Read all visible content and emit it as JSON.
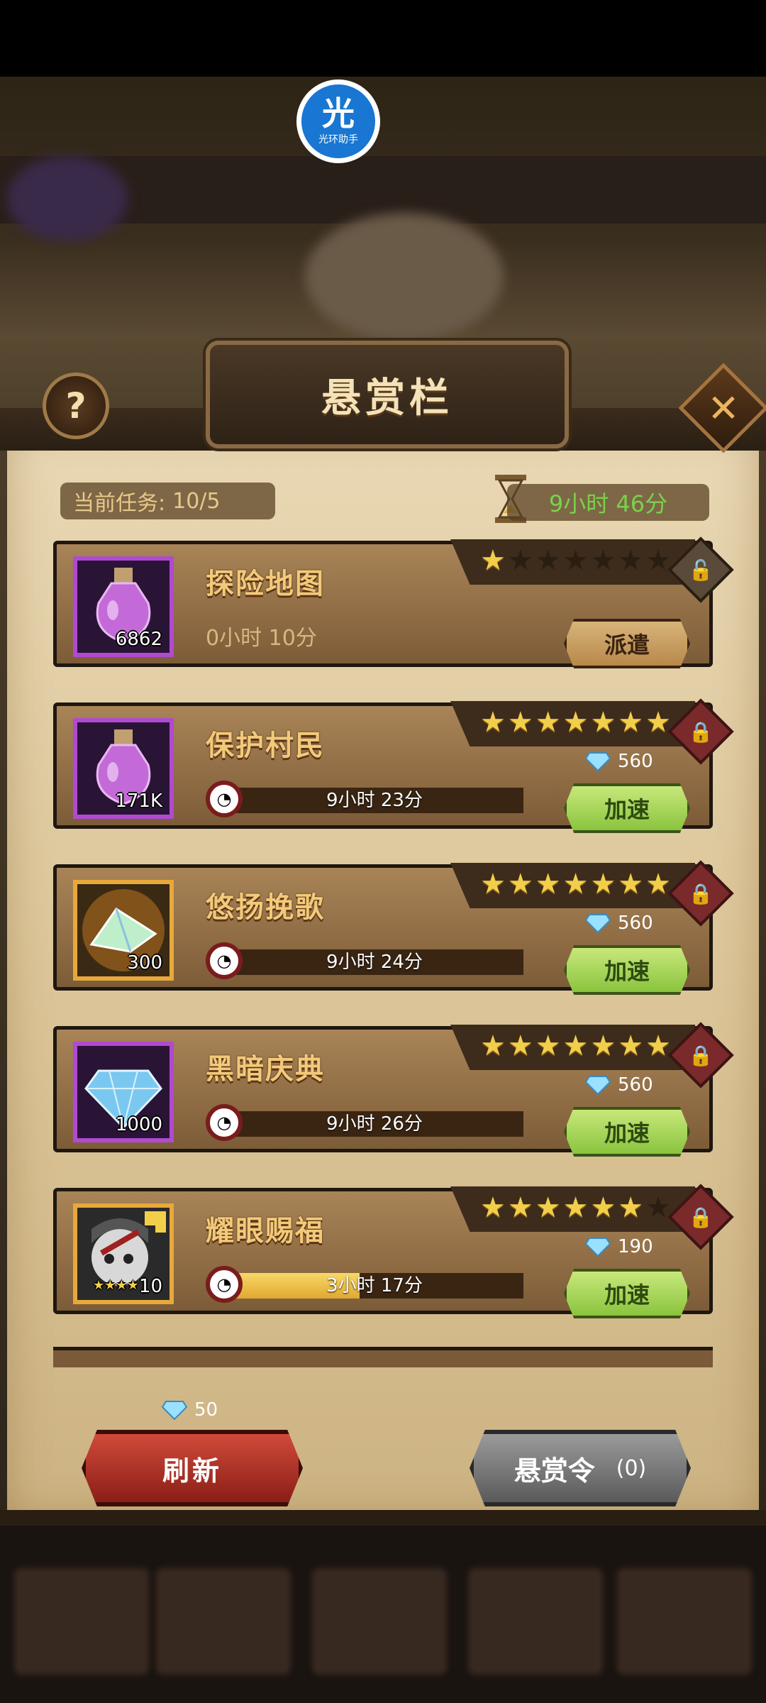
{
  "assistant": {
    "glyph": "光",
    "caption": "光环助手"
  },
  "panel": {
    "title": "悬赏栏",
    "help_label": "?",
    "close_label": "✕"
  },
  "summary": {
    "task_label": "当前任务:",
    "task_value": "10/5",
    "timer": "9小时 46分"
  },
  "tasks": [
    {
      "name": "探险地图",
      "qty": "6862",
      "stars_on": 1,
      "stars_total": 7,
      "lock": "open",
      "time": "0小时 10分",
      "action": "派遣",
      "icon": "potion-icon"
    },
    {
      "name": "保护村民",
      "qty": "171K",
      "stars_on": 7,
      "stars_total": 7,
      "lock": "locked",
      "time": "9小时 23分",
      "gem": "560",
      "action": "加速",
      "progress": 0,
      "icon": "potion-icon"
    },
    {
      "name": "悠扬挽歌",
      "qty": "300",
      "stars_on": 7,
      "stars_total": 7,
      "lock": "locked",
      "time": "9小时 24分",
      "gem": "560",
      "action": "加速",
      "progress": 0,
      "icon": "crystal-icon"
    },
    {
      "name": "黑暗庆典",
      "qty": "1000",
      "stars_on": 7,
      "stars_total": 7,
      "lock": "locked",
      "time": "9小时 26分",
      "gem": "560",
      "action": "加速",
      "progress": 0,
      "icon": "diamond-icon"
    },
    {
      "name": "耀眼赐福",
      "qty": "10",
      "qty_stars": "★★★★",
      "stars_on": 6,
      "stars_total": 7,
      "lock": "locked",
      "time": "3小时 17分",
      "gem": "190",
      "action": "加速",
      "progress": 0.45,
      "icon": "hero-shard-icon"
    }
  ],
  "footer": {
    "refresh_cost": "50",
    "refresh_label": "刷新",
    "bounty_label": "悬赏令",
    "bounty_count": "(0)"
  },
  "colors": {
    "timer_green": "#7ad14a",
    "speed_green": "#8ac43e",
    "refresh_red": "#d04a3a",
    "title_gold": "#f3c97a"
  }
}
